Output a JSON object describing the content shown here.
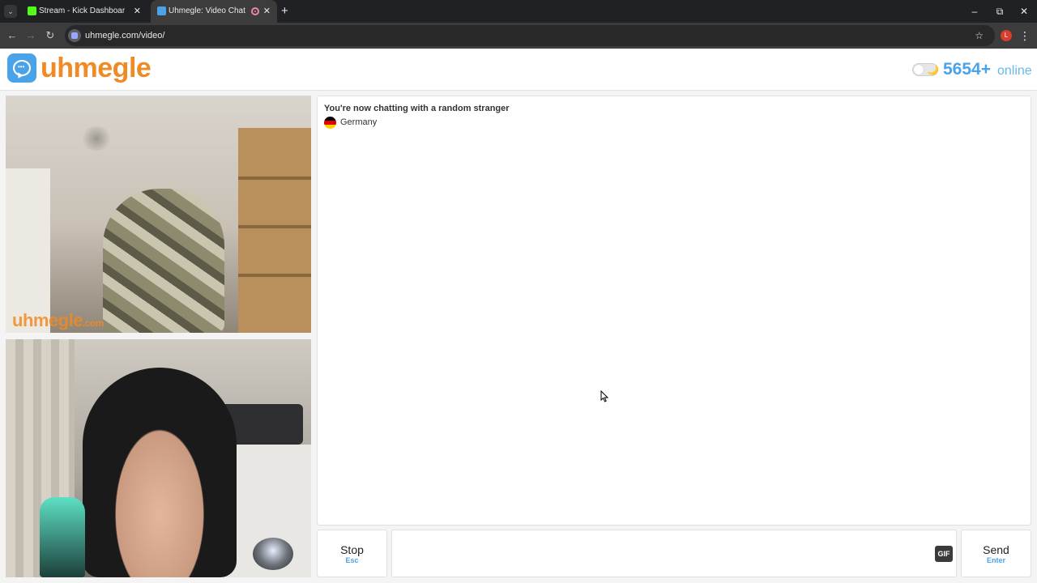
{
  "browser": {
    "tabs": [
      {
        "title": "Stream - Kick Dashboard",
        "favicon_color": "#53fc18",
        "active": false
      },
      {
        "title": "Uhmegle: Video Chat | Rand",
        "favicon_color": "#4aa3e8",
        "active": true
      }
    ],
    "new_tab_glyph": "+",
    "window_controls": {
      "minimize": "–",
      "restore": "⧉",
      "close": "✕"
    },
    "nav": {
      "back": "←",
      "forward": "→",
      "reload": "↻"
    },
    "url": "uhmegle.com/video/",
    "bookmark_glyph": "☆",
    "profile_initial": "L",
    "menu_glyph": "⋮",
    "tab_close_glyph": "✕",
    "tab_search_glyph": "⌄"
  },
  "site": {
    "logo_text": "uhmegle",
    "logo_dots": "•••",
    "online_count": "5654+",
    "online_label": "online",
    "theme_toggle_glyph": "🌙",
    "brand_color": "#f08a24",
    "accent_color": "#4aa3e8"
  },
  "video": {
    "stranger_watermark": "uhmegle",
    "stranger_watermark_domain": ".com"
  },
  "chat": {
    "status": "You're now chatting with a random stranger",
    "country": "Germany",
    "flag_colors": [
      "#000000",
      "#dd0000",
      "#ffce00"
    ]
  },
  "controls": {
    "stop_label": "Stop",
    "stop_hint": "Esc",
    "message_value": "",
    "gif_label": "GIF",
    "send_label": "Send",
    "send_hint": "Enter"
  }
}
